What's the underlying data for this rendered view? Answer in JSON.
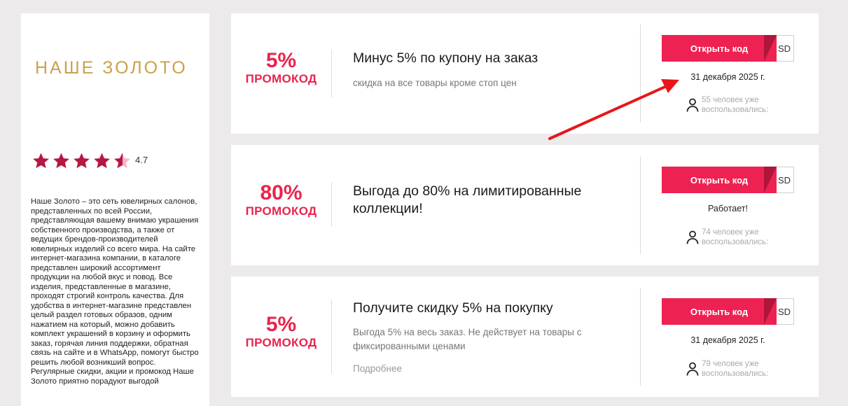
{
  "store": {
    "logo_text": "НАШЕ ЗОЛОТО",
    "rating": "4.7",
    "stars_full": 4,
    "stars_half": 1,
    "description": "Наше Золото – это сеть ювелирных салонов, представленных по всей России, представляющая вашему внимаю украшения собственного производства, а также от ведущих брендов-производителей ювелирных изделий со всего мира. На сайте интернет-магазина компании, в каталоге представлен широкий ассортимент продукции на любой вкус и повод. Все изделия, представленные в магазине, проходят строгий контроль качества. Для удобства в интернет-магазине представлен целый раздел готовых образов, одним нажатием на который, можно добавить комплект украшений в корзину и оформить заказ, горячая линия поддержки, обратная связь на сайте и в WhatsApp, помогут быстро решить любой возникший вопрос. Регулярные скидки, акции и промокод Наше Золото приятно порадуют выгодой"
  },
  "coupons": [
    {
      "discount": "5%",
      "type_label": "ПРОМОКОД",
      "title": "Минус 5% по купону на заказ",
      "subtitle": "скидка на все товары кроме стоп цен",
      "button_label": "Открыть код",
      "code_peek": "SD",
      "status": "31 декабря 2025 г.",
      "users_text": "55 человек уже воспользовались:"
    },
    {
      "discount": "80%",
      "type_label": "ПРОМОКОД",
      "title": "Выгода до 80% на лимитированные коллекции!",
      "button_label": "Открыть код",
      "code_peek": "SD",
      "status": "Работает!",
      "users_text": "74 человек уже воспользовались:"
    },
    {
      "discount": "5%",
      "type_label": "ПРОМОКОД",
      "title": "Получите скидку 5% на покупку",
      "subtitle": "Выгода 5% на весь заказ. Не действует на товары с фиксированными ценами",
      "more_label": "Подробнее",
      "button_label": "Открыть код",
      "code_peek": "SD",
      "status": "31 декабря 2025 г.",
      "users_text": "79 человек уже воспользовались:"
    }
  ],
  "colors": {
    "accent": "#ee2252",
    "accent_dark": "#b0153b",
    "star": "#b51842",
    "logo": "#c9a24b",
    "annotation_arrow": "#e8161b"
  }
}
